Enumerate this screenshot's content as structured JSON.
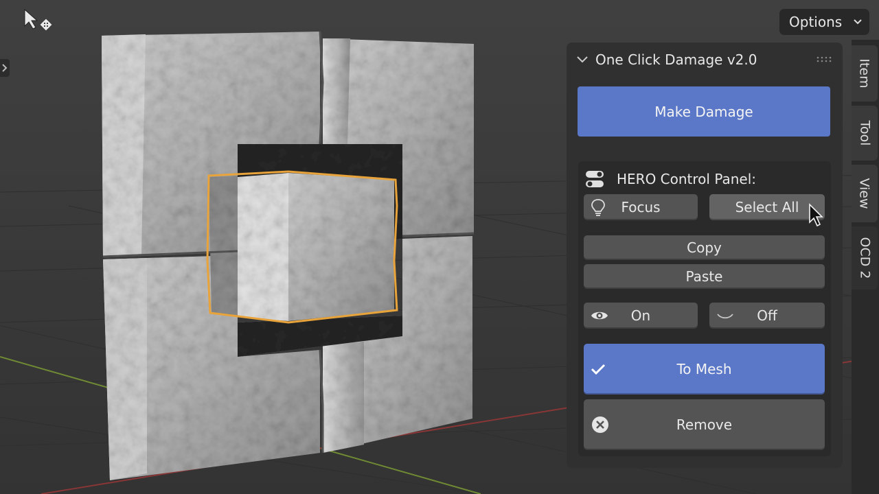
{
  "toolbar": {
    "options_label": "Options"
  },
  "sidebar_tabs": [
    "Item",
    "Tool",
    "View",
    "OCD 2"
  ],
  "addon_panel": {
    "title": "One Click Damage v2.0",
    "make_damage_label": "Make Damage",
    "hero": {
      "title": "HERO Control Panel:",
      "focus_label": "Focus",
      "select_all_label": "Select All",
      "copy_label": "Copy",
      "paste_label": "Paste",
      "on_label": "On",
      "off_label": "Off",
      "to_mesh_label": "To Mesh",
      "remove_label": "Remove"
    }
  },
  "colors": {
    "accent_blue": "#5b77c7",
    "selection_outline": "#e8a33a",
    "x_axis": "#a33c3c",
    "y_axis": "#8aa33a"
  },
  "icons": [
    "move-tool-icon",
    "lightbulb-icon",
    "eye-icon",
    "eye-closed-icon",
    "checkmark-icon",
    "remove-x-icon",
    "toggle-icon"
  ]
}
